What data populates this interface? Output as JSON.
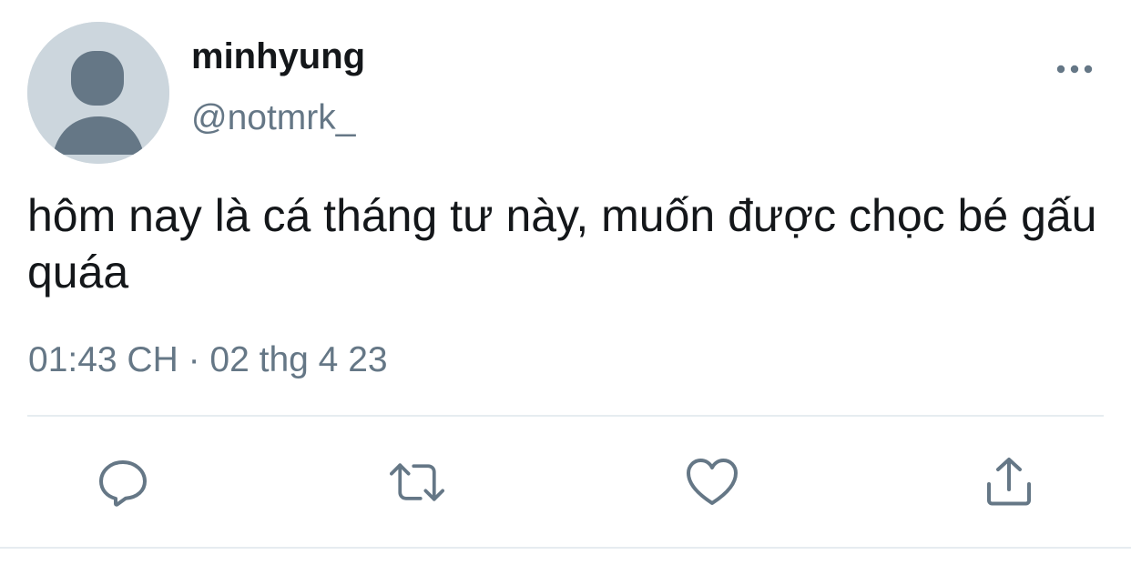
{
  "tweet": {
    "display_name": "minhyung",
    "handle": "@notmrk_",
    "text": "hôm nay là cá tháng tư này, muốn được chọc bé gấu quáa",
    "timestamp": "01:43 CH · 02 thg 4 23"
  },
  "icons": {
    "avatar": "default-avatar-icon",
    "more": "more-horizontal-icon",
    "reply": "reply-icon",
    "retweet": "retweet-icon",
    "like": "heart-icon",
    "share": "share-icon"
  },
  "colors": {
    "text_primary": "#14171a",
    "text_secondary": "#657786",
    "icon": "#657786",
    "avatar_bg": "#ccd6dd",
    "avatar_fg": "#657786",
    "divider": "#e6ecf0"
  }
}
